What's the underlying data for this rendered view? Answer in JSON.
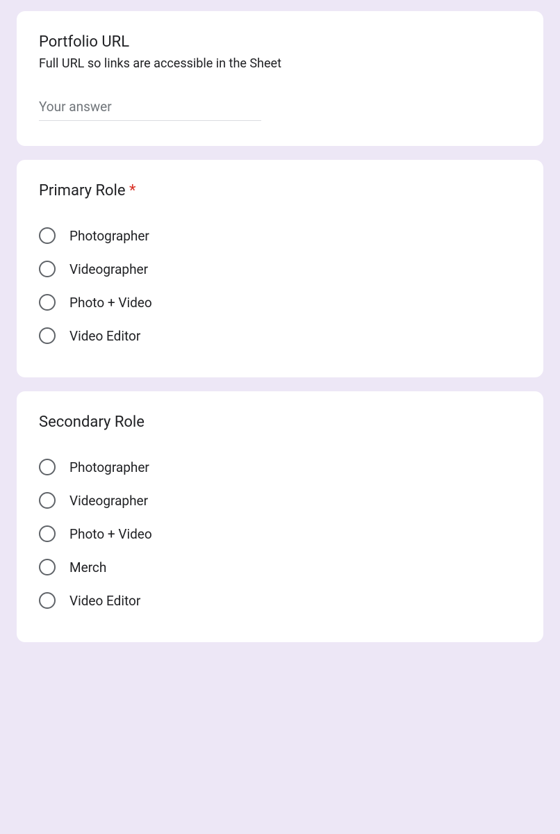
{
  "portfolio": {
    "title": "Portfolio URL",
    "description": "Full URL so links are accessible in the Sheet",
    "placeholder": "Your answer"
  },
  "primaryRole": {
    "title": "Primary Role",
    "required": "*",
    "options": [
      "Photographer",
      "Videographer",
      "Photo + Video",
      "Video Editor"
    ]
  },
  "secondaryRole": {
    "title": "Secondary Role",
    "options": [
      "Photographer",
      "Videographer",
      "Photo + Video",
      "Merch",
      "Video Editor"
    ]
  }
}
